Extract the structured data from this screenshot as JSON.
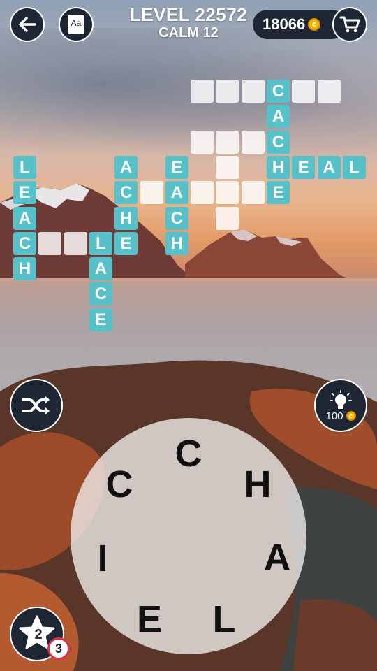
{
  "header": {
    "level_title": "LEVEL 22572",
    "level_subtitle": "CALM 12",
    "coins": "18066",
    "coin_symbol": "c"
  },
  "icons": {
    "back": "back-arrow-icon",
    "dictionary": "dictionary-icon",
    "dictionary_label": "Aa",
    "shop": "shopping-cart-icon",
    "shuffle": "shuffle-icon",
    "hint": "lightbulb-icon",
    "star": "star-icon"
  },
  "hint": {
    "cost": "100"
  },
  "star": {
    "count": "2",
    "badge": "3"
  },
  "wheel": {
    "letters": [
      "C",
      "H",
      "A",
      "L",
      "E",
      "I",
      "C"
    ]
  },
  "colors": {
    "tile_filled": "#57c1c9",
    "tile_empty": "#ffffff",
    "button_bg": "#1f2633",
    "coin": "#f4b400"
  },
  "board": {
    "words": [
      {
        "word": "CACHE",
        "revealed": true
      },
      {
        "word": "HEAL",
        "revealed": true
      },
      {
        "word": "LEACH",
        "revealed": true
      },
      {
        "word": "ACHE",
        "revealed": true
      },
      {
        "word": "EACH",
        "revealed": true
      },
      {
        "word": "LACE",
        "revealed": true
      },
      {
        "word": "LE",
        "revealed": true
      }
    ],
    "tiles": [
      {
        "col": 7,
        "row": 0,
        "ch": ""
      },
      {
        "col": 8,
        "row": 0,
        "ch": ""
      },
      {
        "col": 9,
        "row": 0,
        "ch": ""
      },
      {
        "col": 10,
        "row": 0,
        "ch": "C"
      },
      {
        "col": 11,
        "row": 0,
        "ch": ""
      },
      {
        "col": 12,
        "row": 0,
        "ch": ""
      },
      {
        "col": 10,
        "row": 1,
        "ch": "A"
      },
      {
        "col": 7,
        "row": 2,
        "ch": ""
      },
      {
        "col": 8,
        "row": 2,
        "ch": ""
      },
      {
        "col": 9,
        "row": 2,
        "ch": ""
      },
      {
        "col": 10,
        "row": 2,
        "ch": "C"
      },
      {
        "col": 0,
        "row": 3,
        "ch": "L"
      },
      {
        "col": 4,
        "row": 3,
        "ch": "A"
      },
      {
        "col": 6,
        "row": 3,
        "ch": "E"
      },
      {
        "col": 8,
        "row": 3,
        "ch": ""
      },
      {
        "col": 10,
        "row": 3,
        "ch": "H"
      },
      {
        "col": 11,
        "row": 3,
        "ch": "E"
      },
      {
        "col": 12,
        "row": 3,
        "ch": "A"
      },
      {
        "col": 13,
        "row": 3,
        "ch": "L"
      },
      {
        "col": 0,
        "row": 4,
        "ch": "E"
      },
      {
        "col": 4,
        "row": 4,
        "ch": "C"
      },
      {
        "col": 5,
        "row": 4,
        "ch": ""
      },
      {
        "col": 6,
        "row": 4,
        "ch": "A"
      },
      {
        "col": 7,
        "row": 4,
        "ch": ""
      },
      {
        "col": 8,
        "row": 4,
        "ch": ""
      },
      {
        "col": 9,
        "row": 4,
        "ch": ""
      },
      {
        "col": 10,
        "row": 4,
        "ch": "E"
      },
      {
        "col": 0,
        "row": 5,
        "ch": "A"
      },
      {
        "col": 4,
        "row": 5,
        "ch": "H"
      },
      {
        "col": 6,
        "row": 5,
        "ch": "C"
      },
      {
        "col": 8,
        "row": 5,
        "ch": ""
      },
      {
        "col": 0,
        "row": 6,
        "ch": "C"
      },
      {
        "col": 1,
        "row": 6,
        "ch": ""
      },
      {
        "col": 2,
        "row": 6,
        "ch": ""
      },
      {
        "col": 3,
        "row": 6,
        "ch": "L"
      },
      {
        "col": 4,
        "row": 6,
        "ch": "E"
      },
      {
        "col": 6,
        "row": 6,
        "ch": "H"
      },
      {
        "col": 0,
        "row": 7,
        "ch": "H"
      },
      {
        "col": 3,
        "row": 7,
        "ch": "A"
      },
      {
        "col": 3,
        "row": 8,
        "ch": "C"
      },
      {
        "col": 3,
        "row": 9,
        "ch": "E"
      }
    ]
  }
}
